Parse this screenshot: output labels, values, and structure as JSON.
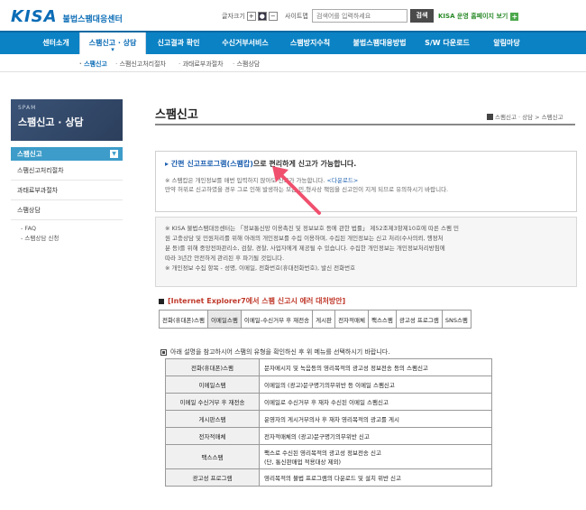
{
  "header": {
    "logo_text": "KISA",
    "logo_sub": "불법스팸대응센터",
    "font_size_label": "글자크기",
    "font_buttons": [
      "+",
      "●",
      "−"
    ],
    "sitemap_label": "사이트맵",
    "search_placeholder": "검색어를 입력하세요",
    "search_button": "검색",
    "home_link": "KISA 운영 홈페이지 보기",
    "home_link_icon": "plus-icon"
  },
  "nav": {
    "items": [
      "센터소개",
      "스팸신고 · 상담",
      "신고결과 확인",
      "수신거부서비스",
      "스팸방지수칙",
      "불법스팸대응방법",
      "S/W 다운로드",
      "알림마당"
    ]
  },
  "subnav": {
    "items": [
      "스팸신고",
      "스팸신고처리절차",
      "과태료부과절차",
      "스팸상담"
    ]
  },
  "sidebar": {
    "banner_en": "SPAM",
    "banner_ko": "스팸신고 · 상담",
    "active": "스팸신고",
    "items": [
      "스팸신고처리절차",
      "과태료부과절차",
      "스팸상담"
    ],
    "subitems": [
      "FAQ",
      "스팸상담 신청"
    ]
  },
  "main": {
    "title": "스팸신고",
    "breadcrumb": "스팸신고 · 상담 > 스팸신고",
    "notice": {
      "lead_link": "간편 신고프로그램(스팸캅)",
      "lead_rest": "으로 편리하게 신고가 가능합니다.",
      "line1_pre": "※ 스팸캅은 개인정보를 매번 입력하지 않아도 신고가 가능합니다.",
      "line1_link": "<다운로드>",
      "line2": "만약 허위로 신고하였을 경우 그로 인해 발생하는 모든 민,형사상 책임을 신고인이 지게 되므로 유의하시기 바랍니다."
    },
    "privacy": {
      "lines": [
        "※ KISA 불법스팸대응센터는 「정보통신망 이용촉진 및 정보보호 등에 관한 법률」 제52조제3항제10호에 따른 스팸 민",
        "원 고충상담 및 민원처리를 위해 아래의 개인정보를 수집 이용하며, 수집된 개인정보는 신고 처리(수사의뢰, 행정처",
        "분 등)를 위해 중앙전파관리소, 검찰, 경찰, 사업자에게 제공될 수 있습니다. 수집한 개인정보는 개인정보처리방침에",
        "따라 3년간 안전하게 관리된 후 파기될 것입니다.",
        "※ 개인정보 수집 항목 - 성명, 이메일, 전화번호(휴대전화번호), 발신 전화번호"
      ]
    },
    "ie_section": {
      "title": "[Internet Explorer7에서 스팸 신고시 에러 대처방안]",
      "cells": [
        "전화(휴대폰)스팸",
        "이메일스팸",
        "이메일-수신거부 후 재전송",
        "게시판",
        "전자적매체",
        "팩스스팸",
        "광고성 프로그램",
        "SNS스팸"
      ]
    },
    "types_section": {
      "title": "아래 설명을 참고하시어 스팸의 유형을 확인하신 후 위 메뉴를 선택하시기 바랍니다.",
      "rows": [
        {
          "k": "전화(휴대폰)스팸",
          "v": "문자메시지 및 녹음등의 영리목적의 광고성 정보전송 등의 스팸신고"
        },
        {
          "k": "이메일스팸",
          "v": "이메일의 (광고)문구명기의무위반 등 이메일 스팸신고"
        },
        {
          "k": "이메일 수신거부 후 재전송",
          "v": "이메일로 수신거부 후 재차 수신된 이메일 스팸신고"
        },
        {
          "k": "게시판스팸",
          "v": "운영자의 게시거부의사 후 재차 영리목적의 광고를 게시"
        },
        {
          "k": "전자적매체",
          "v": "전자적매체의 (광고)문구명기의무위반 신고"
        },
        {
          "k": "팩스스팸",
          "v": "팩스로 수신된 영리목적의 광고성 정보전송 신고",
          "v2": "(단, 통신판매업 적용대상 제외)"
        },
        {
          "k": "광고성 프로그램",
          "v": "영리목적의 불법 프로그램의 다운로드 및 설치 위반 신고"
        }
      ]
    }
  },
  "colors": {
    "nav_bg": "#0b82c4",
    "brand_blue": "#0a6cb6",
    "banner_bg": "#2c3f5c",
    "sidebar_active": "#3d9cc9",
    "ie_title_red": "#c0392b",
    "arrow_pink": "#f0506e"
  }
}
